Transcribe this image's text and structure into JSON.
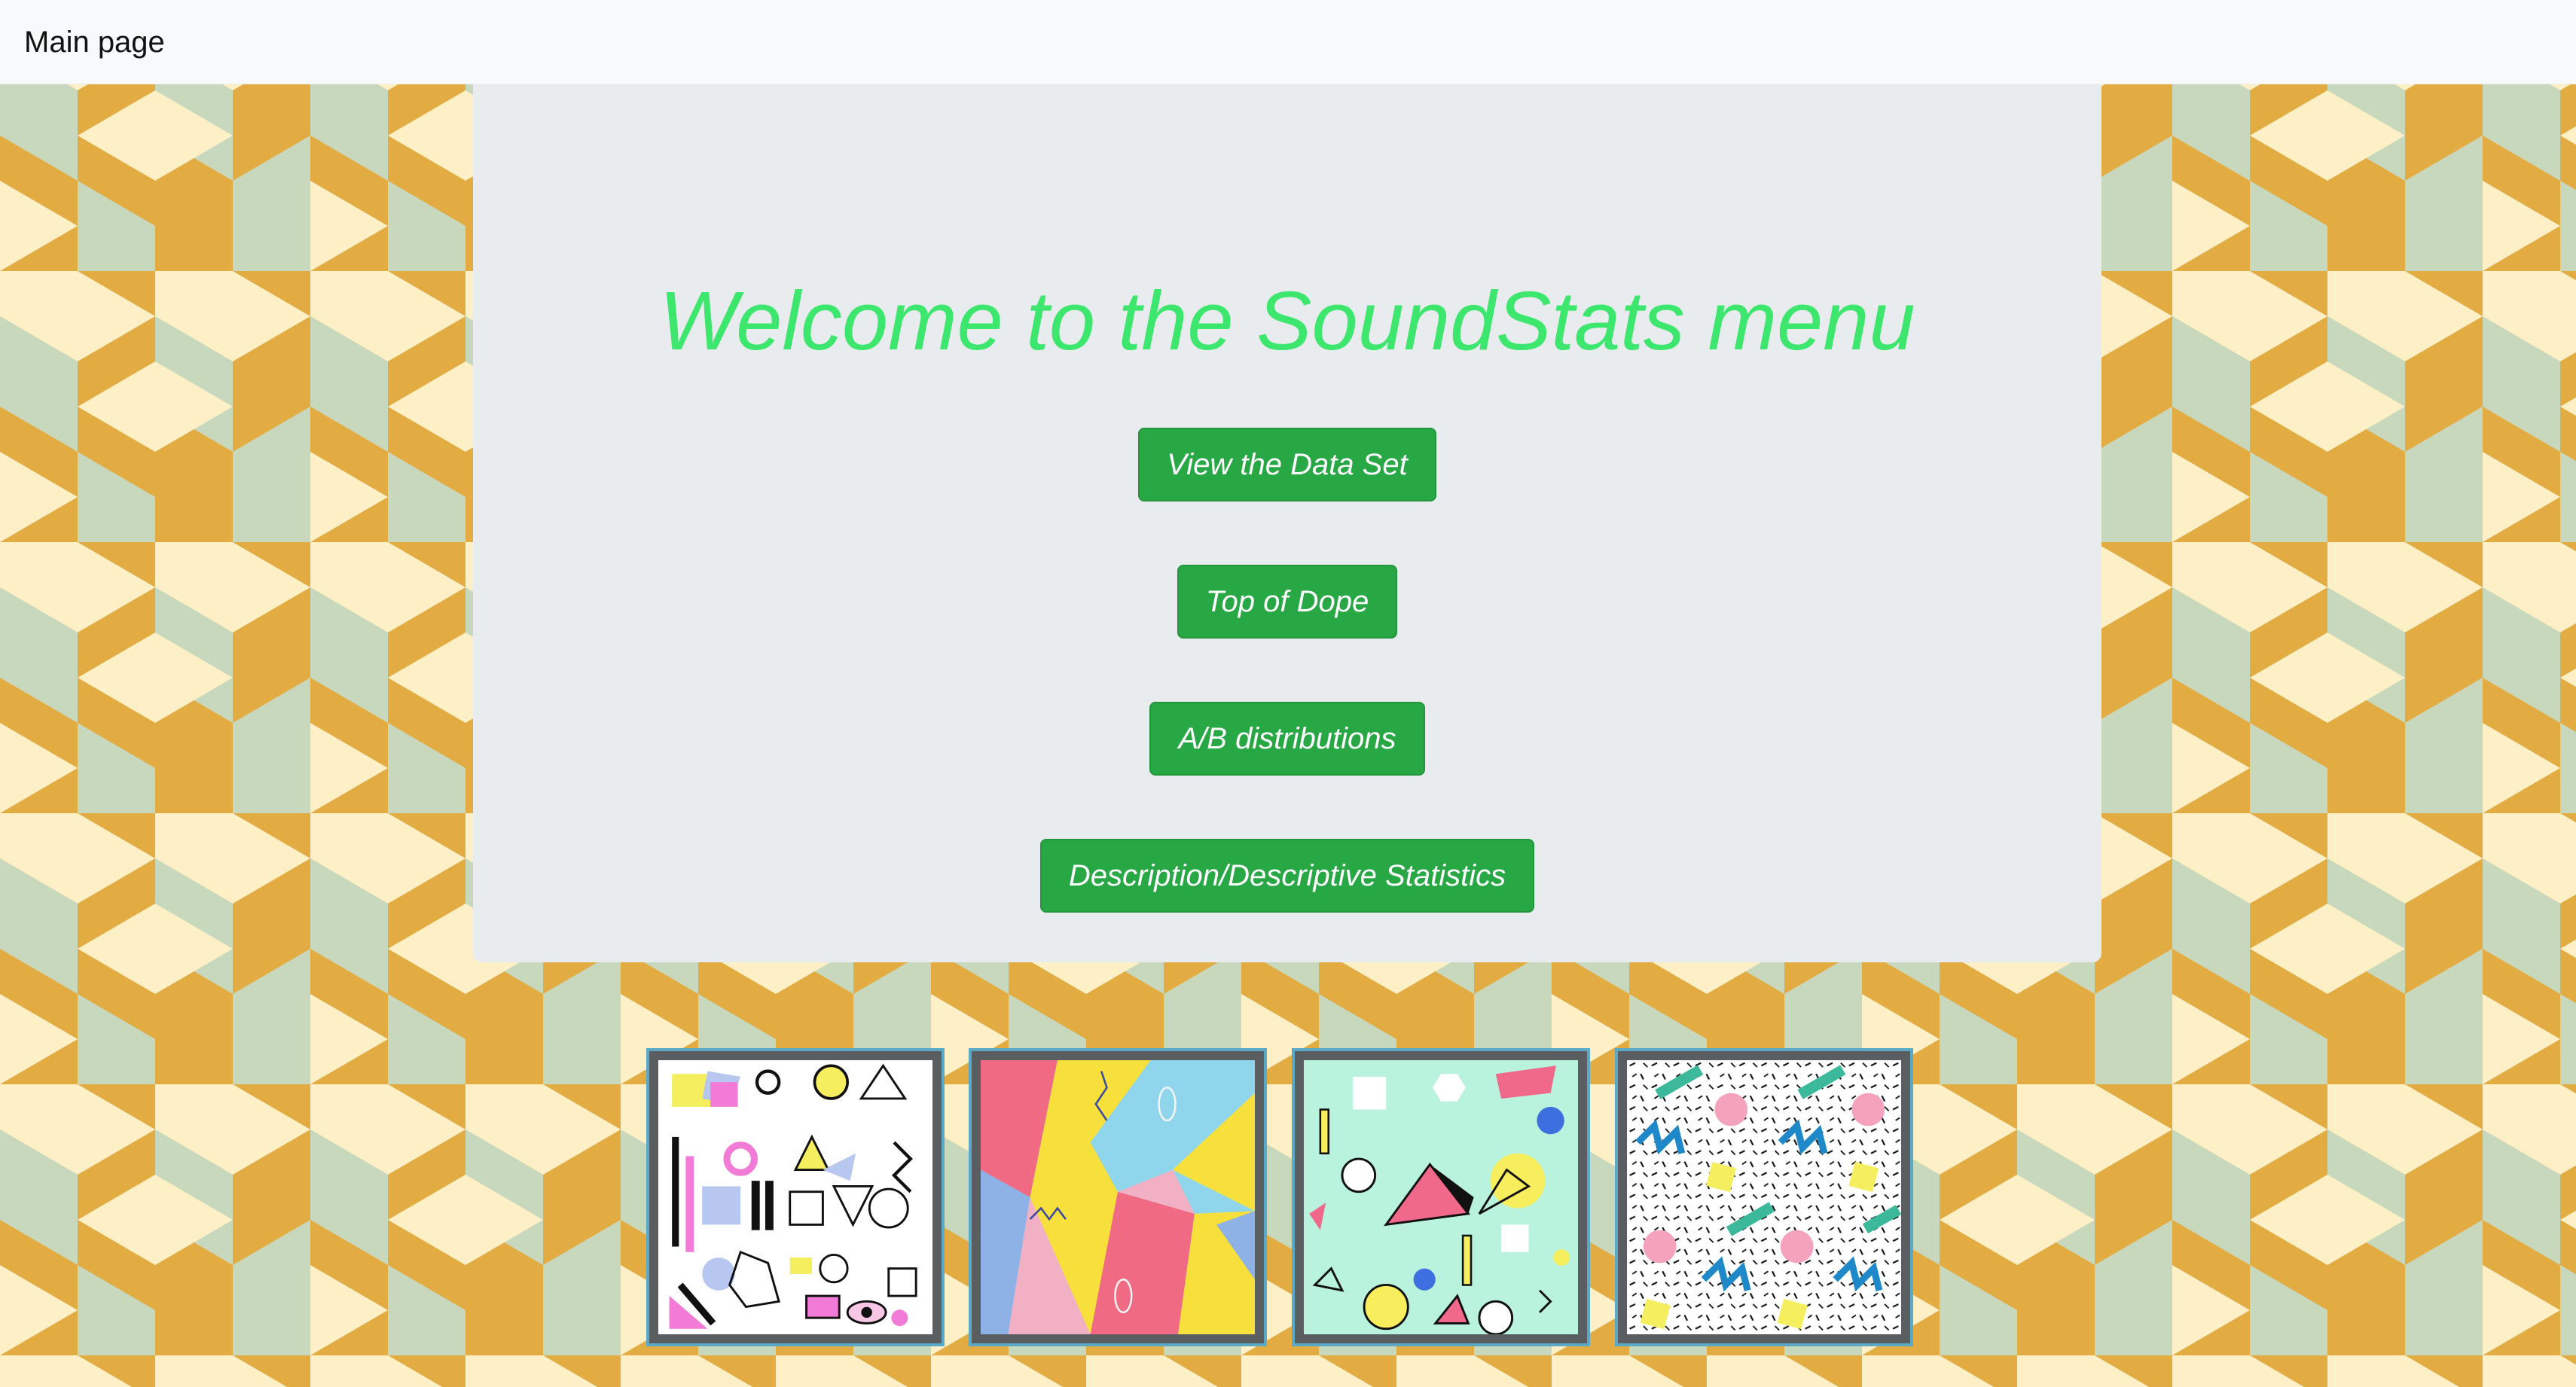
{
  "navbar": {
    "brand": "Main page"
  },
  "hero": {
    "title": "Welcome to the SoundStats menu",
    "title_color": "#3de66d"
  },
  "buttons": [
    {
      "label": "View the Data Set"
    },
    {
      "label": "Top of Dope"
    },
    {
      "label": "A/B distributions"
    },
    {
      "label": "Description/Descriptive Statistics"
    }
  ],
  "thumbnails": [
    {
      "name": "memphis-pattern-shapes-white"
    },
    {
      "name": "memphis-pattern-polygons-colorful"
    },
    {
      "name": "memphis-pattern-pyramids-mint"
    },
    {
      "name": "memphis-pattern-zigzag-speckle"
    }
  ],
  "colors": {
    "background_orange": "#e3ac42",
    "background_cream": "#fdf0c7",
    "background_sage": "#c8d8bd",
    "button_green": "#28a745",
    "panel_gray": "#e9ecef",
    "thumbnail_border": "#5aa9c7"
  }
}
